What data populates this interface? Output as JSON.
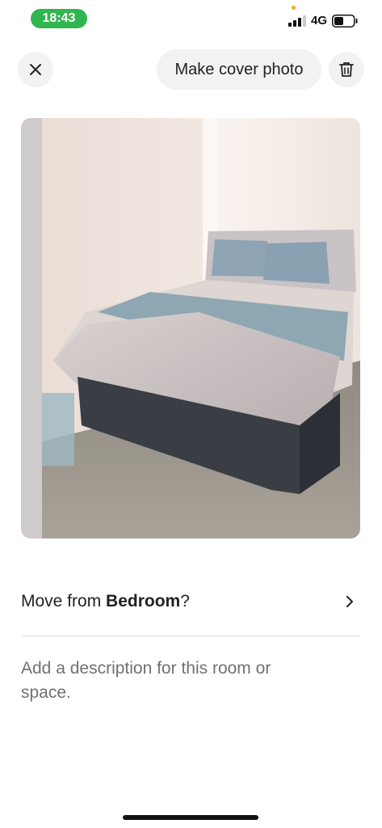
{
  "status_bar": {
    "time": "18:43",
    "network": "4G",
    "icons": [
      "signal-icon",
      "battery-icon"
    ],
    "colors": {
      "time_pill": "#30b650",
      "privacy_dot": "#f5a623"
    }
  },
  "toolbar": {
    "close_icon": "close-icon",
    "cover_label": "Make cover photo",
    "delete_icon": "trash-icon"
  },
  "photo": {
    "subject": "bed-photo"
  },
  "move": {
    "prefix": "Move from ",
    "room": "Bedroom",
    "suffix": "?",
    "icon": "chevron-right-icon"
  },
  "description": {
    "placeholder": "Add a description for this room or space."
  }
}
